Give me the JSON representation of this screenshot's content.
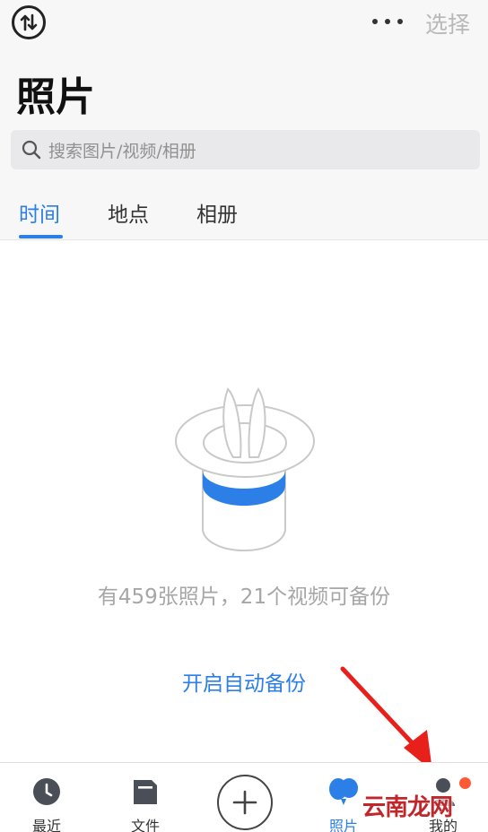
{
  "header": {
    "select_label": "选择",
    "title": "照片",
    "search_placeholder": "搜索图片/视频/相册"
  },
  "tabs": [
    {
      "label": "时间",
      "active": true
    },
    {
      "label": "地点",
      "active": false
    },
    {
      "label": "相册",
      "active": false
    }
  ],
  "empty_state": {
    "message": "有459张照片，21个视频可备份",
    "action_label": "开启自动备份"
  },
  "bottom_nav": {
    "items": [
      {
        "label": "最近",
        "icon": "clock-icon",
        "active": false
      },
      {
        "label": "文件",
        "icon": "folder-icon",
        "active": false
      },
      {
        "label": "照片",
        "icon": "photos-balloon-icon",
        "active": true
      },
      {
        "label": "我的",
        "icon": "person-icon",
        "active": false,
        "has_notification": true
      }
    ],
    "center_icon": "plus-icon"
  },
  "watermark": "云南龙网",
  "colors": {
    "accent": "#2b7fe6",
    "notification": "#ff5a36",
    "annotation_arrow": "#e8201b"
  }
}
